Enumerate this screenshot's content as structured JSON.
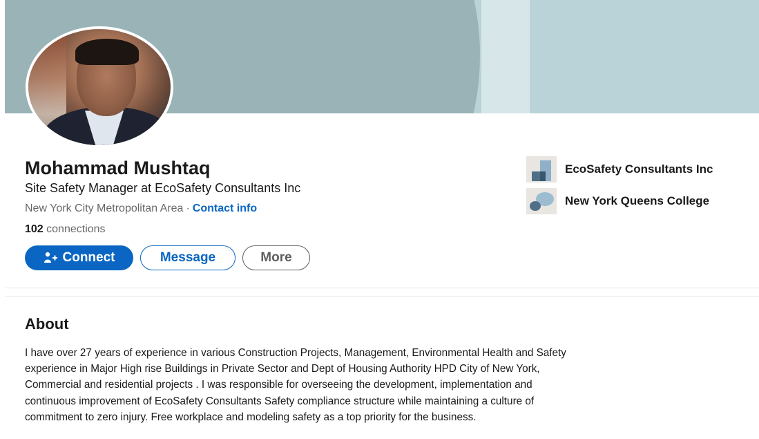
{
  "profile": {
    "name": "Mohammad Mushtaq",
    "headline": "Site Safety Manager at EcoSafety Consultants Inc",
    "location": "New York City Metropolitan Area",
    "separator": "·",
    "contact_info": "Contact info",
    "connections_count": "102",
    "connections_label": "connections"
  },
  "actions": {
    "connect_label": "Connect",
    "message_label": "Message",
    "more_label": "More"
  },
  "organizations": [
    {
      "name": "EcoSafety Consultants Inc",
      "icon": "company-logo-icon"
    },
    {
      "name": "New York Queens College",
      "icon": "school-logo-icon"
    }
  ],
  "about": {
    "title": "About",
    "lines": [
      "I have over 27 years of experience in various Construction Projects, Management, Environmental Health and Safety",
      "experience in Major High rise Buildings in Private Sector and Dept of Housing Authority HPD City of New York,",
      "Commercial and residential projects . I was responsible for overseeing the development, implementation and",
      "continuous improvement of EcoSafety Consultants Safety compliance structure while maintaining a culture of",
      "commitment to zero injury. Free workplace and modeling safety as a top priority for the business."
    ]
  },
  "colors": {
    "brand_blue": "#0a66c2",
    "banner_dark": "#9ab3b7",
    "banner_light": "#b9d3d8",
    "banner_stripe": "#d7e6e8"
  }
}
